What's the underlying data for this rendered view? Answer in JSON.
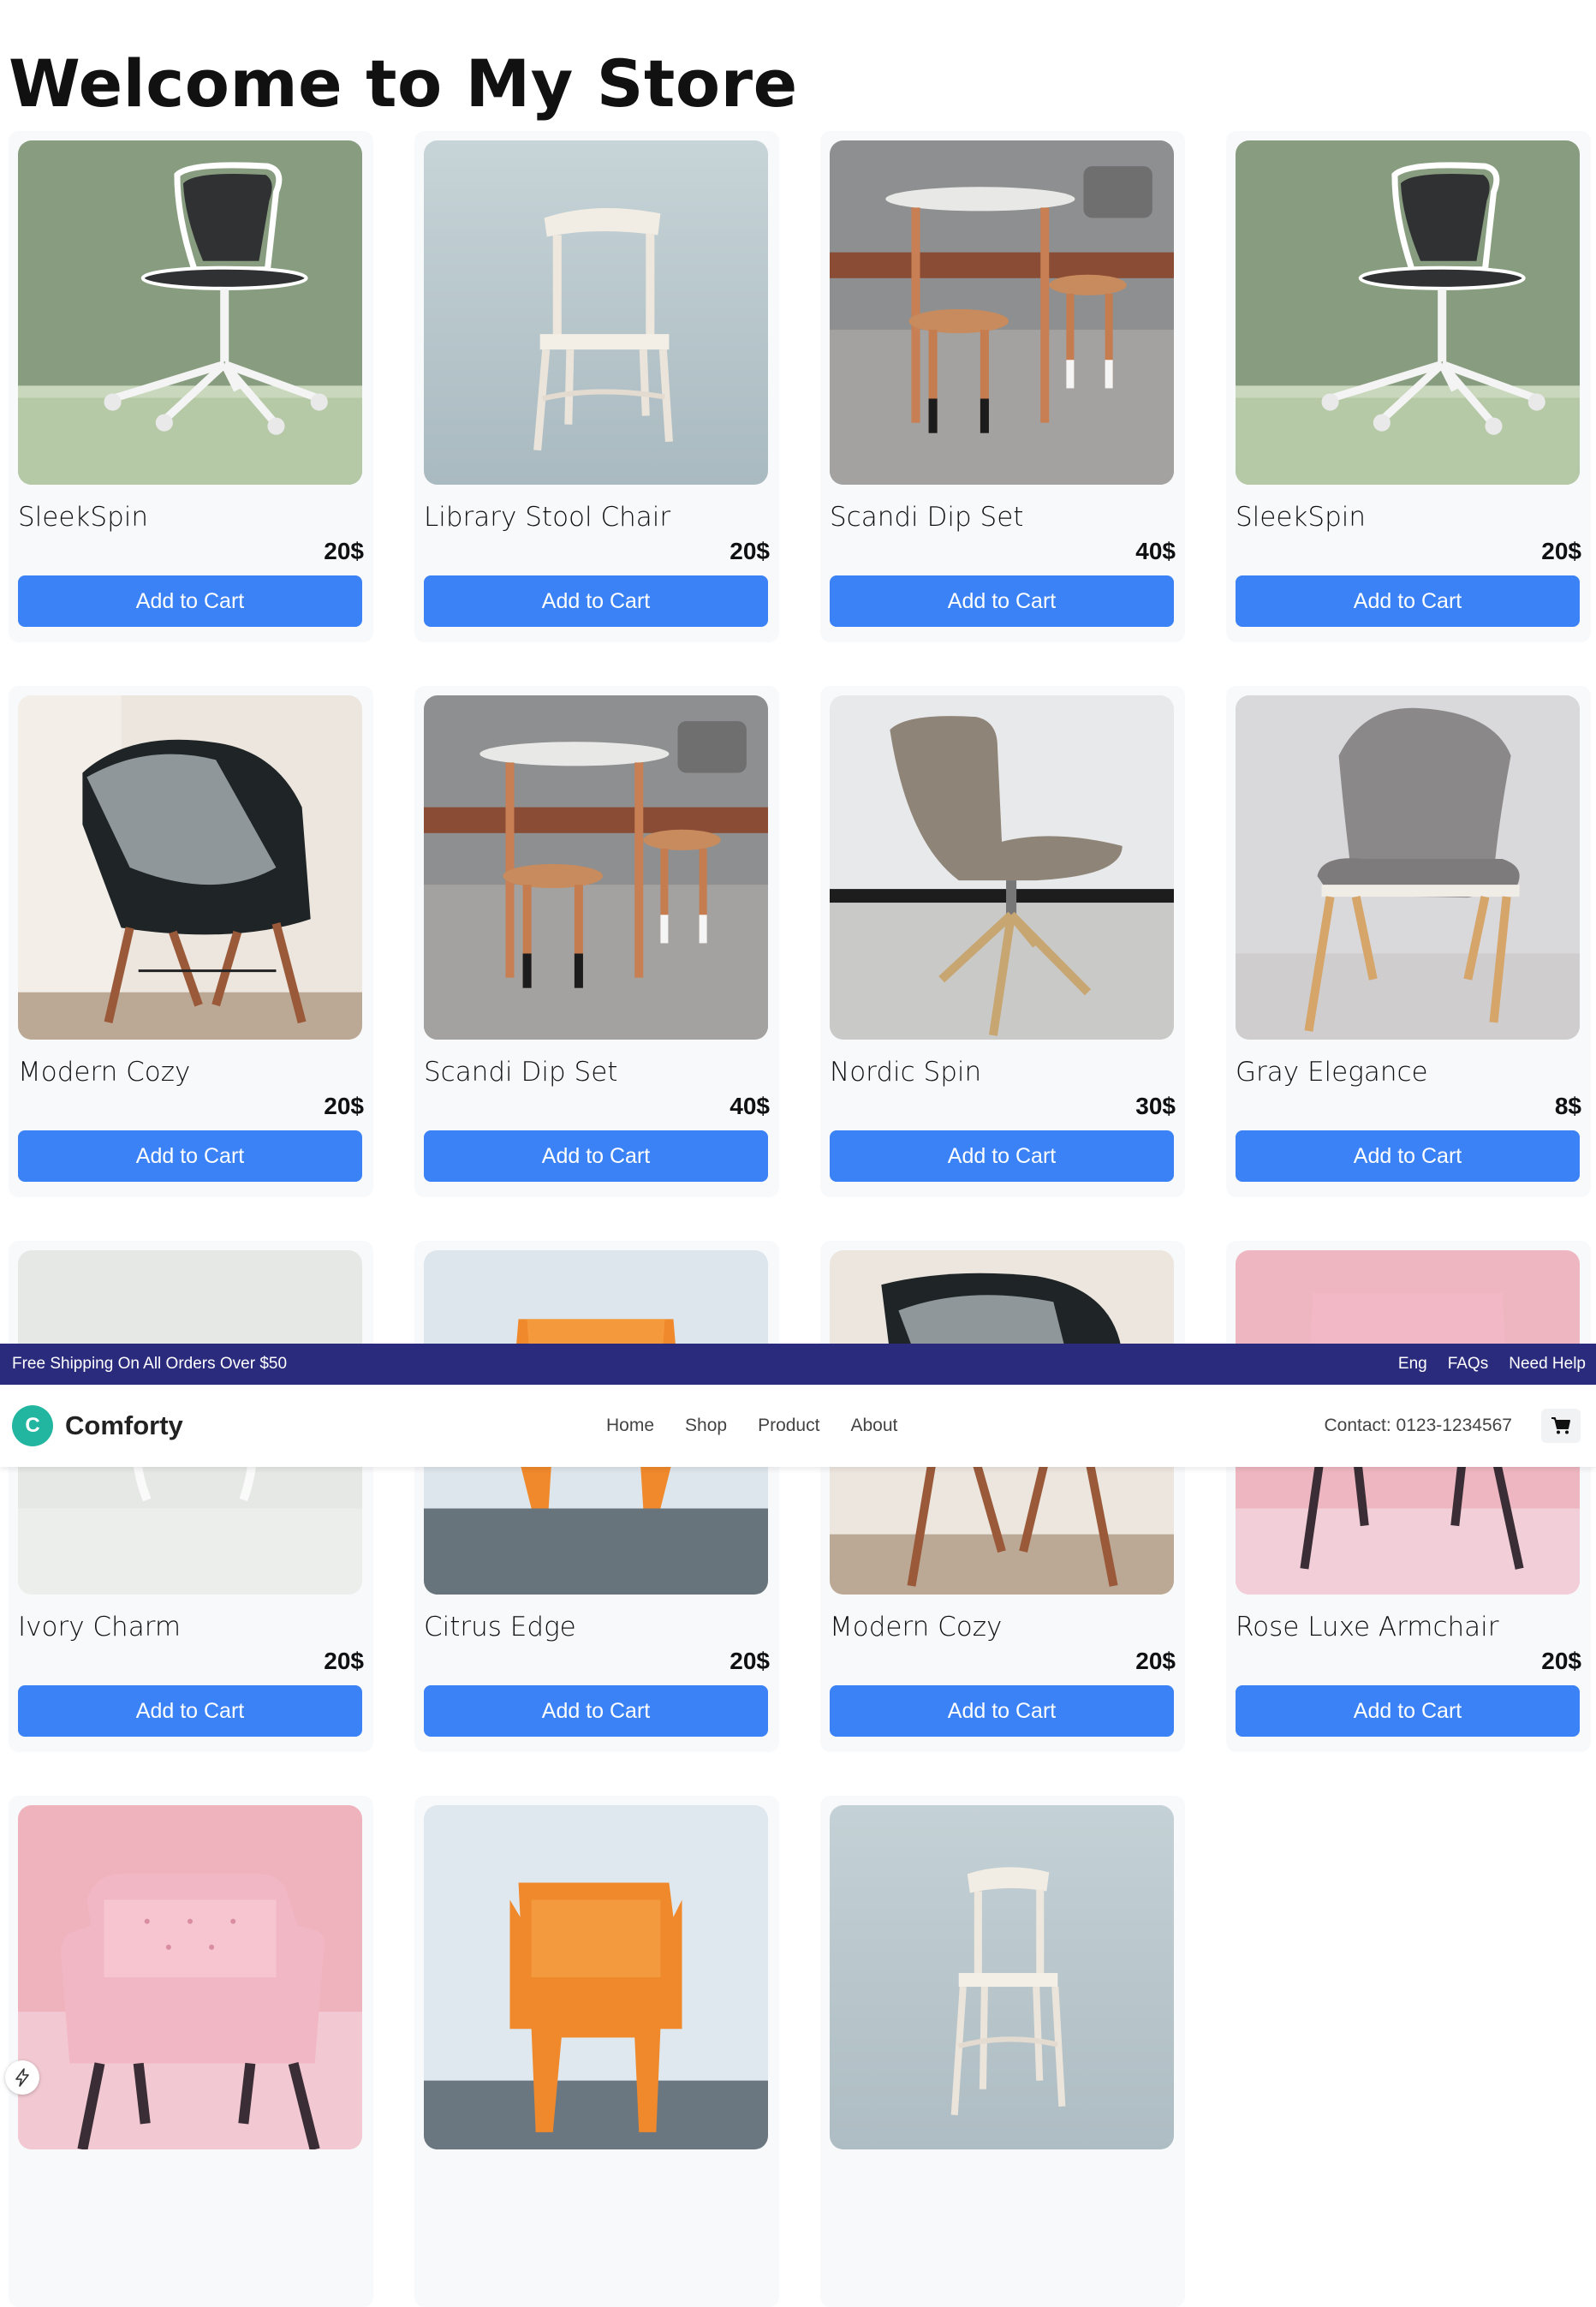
{
  "page": {
    "title": "Welcome to My Store"
  },
  "products": [
    {
      "name": "SleekSpin",
      "price": "20$",
      "image": "swivel-desk-chair-image",
      "cta": "Add to Cart"
    },
    {
      "name": "Library Stool Chair",
      "price": "20$",
      "image": "white-wooden-chair-image",
      "cta": "Add to Cart"
    },
    {
      "name": "Scandi Dip Set",
      "price": "40$",
      "image": "table-stools-set-image",
      "cta": "Add to Cart"
    },
    {
      "name": "SleekSpin",
      "price": "20$",
      "image": "swivel-desk-chair-image",
      "cta": "Add to Cart"
    },
    {
      "name": "Modern Cozy",
      "price": "20$",
      "image": "black-shell-chair-image",
      "cta": "Add to Cart"
    },
    {
      "name": "Scandi Dip Set",
      "price": "40$",
      "image": "table-stools-set-image",
      "cta": "Add to Cart"
    },
    {
      "name": "Nordic Spin",
      "price": "30$",
      "image": "lounge-swivel-chair-image",
      "cta": "Add to Cart"
    },
    {
      "name": "Gray Elegance",
      "price": "8$",
      "image": "gray-upholstered-chair-image",
      "cta": "Add to Cart"
    },
    {
      "name": "Ivory Charm",
      "price": "20$",
      "image": "white-ornate-chair-image",
      "cta": "Add to Cart"
    },
    {
      "name": "Citrus Edge",
      "price": "20$",
      "image": "orange-chair-image",
      "cta": "Add to Cart"
    },
    {
      "name": "Modern Cozy",
      "price": "20$",
      "image": "black-shell-chair-image",
      "cta": "Add to Cart"
    },
    {
      "name": "Rose Luxe Armchair",
      "price": "20$",
      "image": "pink-armchair-image",
      "cta": "Add to Cart"
    },
    {
      "name": "",
      "price": "",
      "image": "pink-armchair-image",
      "cta": ""
    },
    {
      "name": "",
      "price": "",
      "image": "orange-chair-image",
      "cta": ""
    },
    {
      "name": "",
      "price": "",
      "image": "white-wooden-chair-image",
      "cta": ""
    }
  ],
  "promo_bar": {
    "text": "Free Shipping On All Orders Over $50",
    "links": [
      "Eng",
      "FAQs",
      "Need Help"
    ]
  },
  "navbar": {
    "logo_letter": "C",
    "brand": "Comforty",
    "links": [
      "Home",
      "Shop",
      "Product",
      "About"
    ],
    "contact": "Contact: 0123-1234567",
    "cart_icon": "cart-icon"
  },
  "colors": {
    "accent_button": "#3b82f6",
    "promo_bar_bg": "#2a2b7d",
    "logo_bg": "#22b5a0",
    "card_bg": "#f8f9fb"
  }
}
